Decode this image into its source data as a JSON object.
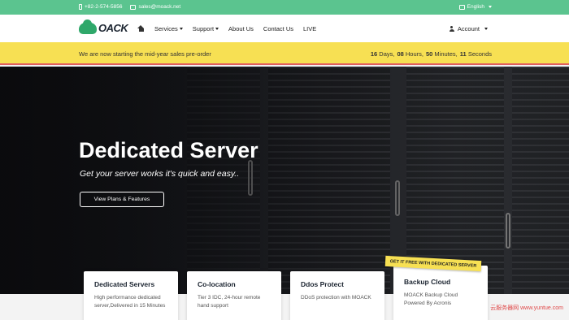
{
  "topbar": {
    "phone": "+82-2-574-5856",
    "email": "sales@moack.net",
    "language": "English"
  },
  "nav": {
    "logo_text": "OACK",
    "items": [
      {
        "label": "Services",
        "dropdown": true
      },
      {
        "label": "Support",
        "dropdown": true
      },
      {
        "label": "About Us",
        "dropdown": false
      },
      {
        "label": "Contact Us",
        "dropdown": false
      },
      {
        "label": "LIVE",
        "dropdown": false
      }
    ],
    "account": "Account"
  },
  "promo": {
    "message": "We are now starting the mid-year sales pre-order",
    "countdown": {
      "days_value": "16",
      "days_label": "Days,",
      "hours_value": "08",
      "hours_label": "Hours,",
      "minutes_value": "50",
      "minutes_label": "Minutes,",
      "seconds_value": "11",
      "seconds_label": "Seconds"
    }
  },
  "hero": {
    "title": "Dedicated Server",
    "subtitle": "Get your server works it's quick and easy..",
    "button": "View Plans & Features"
  },
  "cards": [
    {
      "title": "Dedicated Servers",
      "desc": "High performance dedicated server,Delivered in 15 Minutes"
    },
    {
      "title": "Co-location",
      "desc": "Tier 3 IDC, 24-hour remote hand support"
    },
    {
      "title": "Ddos Protect",
      "desc": "DDoS protection with MOACK"
    },
    {
      "title": "Backup Cloud",
      "desc": "MOACK Backup Cloud Powered By Acronis"
    }
  ],
  "ribbon": "GET IT FREE WITH DEDICATED SERVER",
  "watermark": "云服务器网 www.yuntue.com",
  "colors": {
    "topbar": "#5bc48f",
    "promo": "#f7e053",
    "brand": "#2fa86a"
  }
}
